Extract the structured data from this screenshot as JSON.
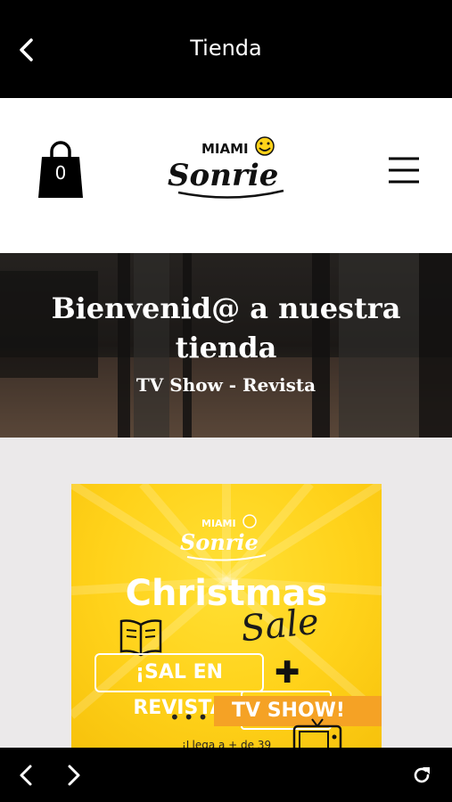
{
  "topbar": {
    "title": "Tienda",
    "back_icon": "chevron-left-icon"
  },
  "header": {
    "cart_count": "0",
    "cart_icon": "shopping-bag-icon",
    "logo_top": "MIAMI",
    "logo_main": "Sonrie",
    "menu_icon": "hamburger-menu-icon"
  },
  "hero": {
    "title": "Bienvenid@ a nuestra tienda",
    "subtitle": "TV Show - Revista"
  },
  "promo": {
    "logo_top": "MIAMI",
    "logo_main": "Sonrie",
    "headline": "Christmas",
    "script": "Sale",
    "magazine_label": "¡SAL EN REVISTA",
    "plus": "✚",
    "dots": "•••",
    "tv_label": "TV SHOW!",
    "small_text": "¡Llega a + de 39",
    "accent": "#ffd21a",
    "orange": "#f5a225"
  },
  "bottombar": {
    "back_icon": "chevron-left-icon",
    "forward_icon": "chevron-right-icon",
    "reload_icon": "reload-icon"
  }
}
